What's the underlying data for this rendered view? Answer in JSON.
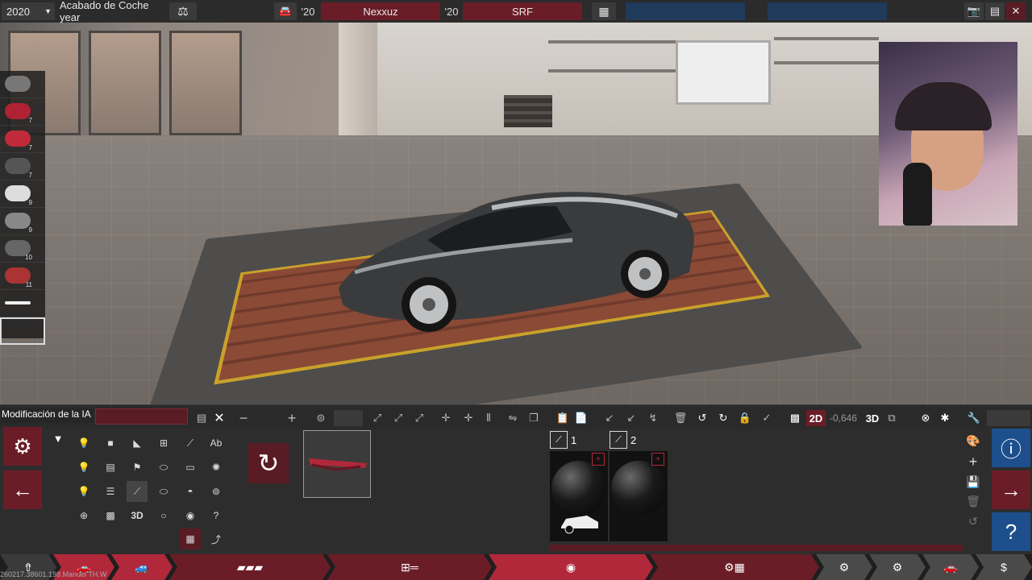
{
  "topbar": {
    "year": "2020",
    "title": "Acabado de Coche year",
    "model_year": "'20",
    "author": "Nexxuz",
    "trim_year": "'20",
    "trim": "SRF"
  },
  "parts_strip": {
    "numbers": [
      "7",
      "7",
      "7",
      "9",
      "9",
      "10",
      "11"
    ]
  },
  "editor": {
    "layer_label": "Modificación de la IA",
    "layer_name_value": "",
    "value_readout": "-0,646",
    "mode_2d": "2D",
    "mode_3d": "3D",
    "text_tool": "Ab",
    "grid_3d": "3D"
  },
  "materials": [
    {
      "index": "1"
    },
    {
      "index": "2"
    }
  ],
  "watermark": "260217.38601.198.Manuel TH.W",
  "colors": {
    "accent_red": "#6b1d27",
    "accent_blue": "#1c4f8c",
    "panel": "#2d2d2d"
  }
}
